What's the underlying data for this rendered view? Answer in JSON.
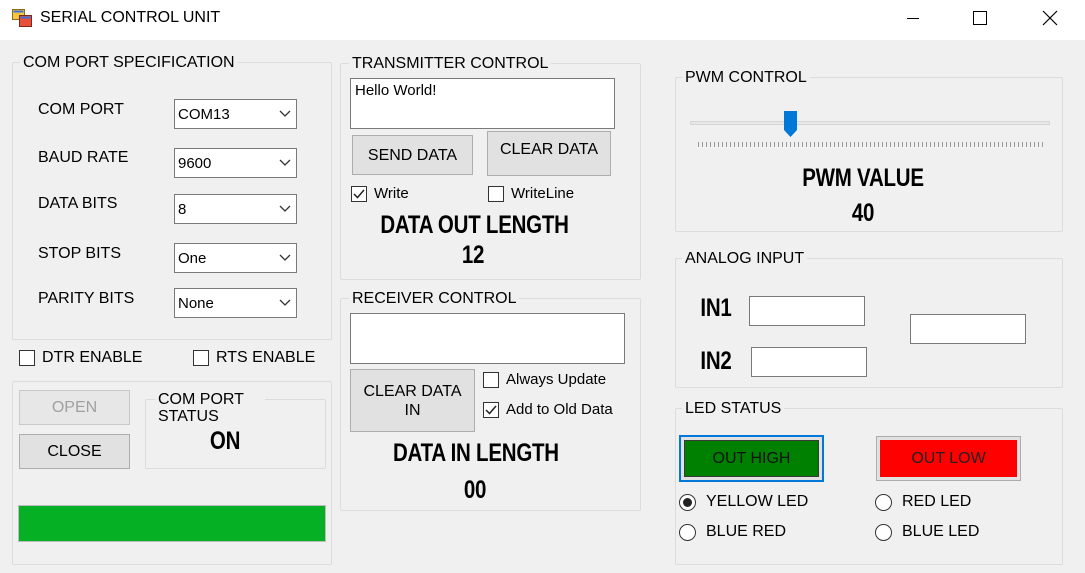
{
  "window": {
    "title": "SERIAL CONTROL UNIT",
    "icons": {
      "app": "app-window-icon",
      "minimize": "minimize-icon",
      "maximize": "maximize-icon",
      "close": "close-icon"
    }
  },
  "com_port_spec": {
    "group_label": "COM PORT SPECIFICATION",
    "fields": {
      "com_port": {
        "label": "COM PORT",
        "value": "COM13"
      },
      "baud_rate": {
        "label": "BAUD RATE",
        "value": "9600"
      },
      "data_bits": {
        "label": "DATA BITS",
        "value": "8"
      },
      "stop_bits": {
        "label": "STOP BITS",
        "value": "One"
      },
      "parity_bits": {
        "label": "PARITY BITS",
        "value": "None"
      }
    },
    "dtr_enable": {
      "label": "DTR ENABLE",
      "checked": false
    },
    "rts_enable": {
      "label": "RTS ENABLE",
      "checked": false
    },
    "open_label": "OPEN",
    "close_label": "CLOSE",
    "status_group_label": "COM PORT STATUS",
    "status_value": "ON",
    "progress": {
      "fraction": 1.0,
      "color": "#06b025"
    }
  },
  "transmitter": {
    "group_label": "TRANSMITTER CONTROL",
    "text_value": "Hello World!",
    "send_label": "SEND DATA",
    "clear_label": "CLEAR DATA",
    "write": {
      "label": "Write",
      "checked": true
    },
    "writeline": {
      "label": "WriteLine",
      "checked": false
    },
    "length_label": "DATA OUT LENGTH",
    "length_value": "12"
  },
  "receiver": {
    "group_label": "RECEIVER CONTROL",
    "text_value": "",
    "clear_label": "CLEAR DATA IN",
    "always_update": {
      "label": "Always Update",
      "checked": false
    },
    "add_to_old": {
      "label": "Add to Old Data",
      "checked": true
    },
    "length_label": "DATA IN LENGTH",
    "length_value": "00"
  },
  "pwm": {
    "group_label": "PWM CONTROL",
    "slider_fraction": 0.27,
    "value_label": "PWM VALUE",
    "value": "40",
    "thumb_color": "#0078d7"
  },
  "analog": {
    "group_label": "ANALOG INPUT",
    "in1_label": "IN1",
    "in2_label": "IN2",
    "in1_value": "",
    "in2_value": "",
    "extra_value": ""
  },
  "led": {
    "group_label": "LED STATUS",
    "out_high_label": "OUT HIGH",
    "out_low_label": "OUT LOW",
    "out_high_color": "#008000",
    "out_low_color": "#ff0000",
    "yellow_led": {
      "label": "YELLOW LED",
      "selected": true
    },
    "blue_red": {
      "label": "BLUE RED",
      "selected": false
    },
    "red_led": {
      "label": "RED LED",
      "selected": false
    },
    "blue_led": {
      "label": "BLUE LED",
      "selected": false
    }
  }
}
